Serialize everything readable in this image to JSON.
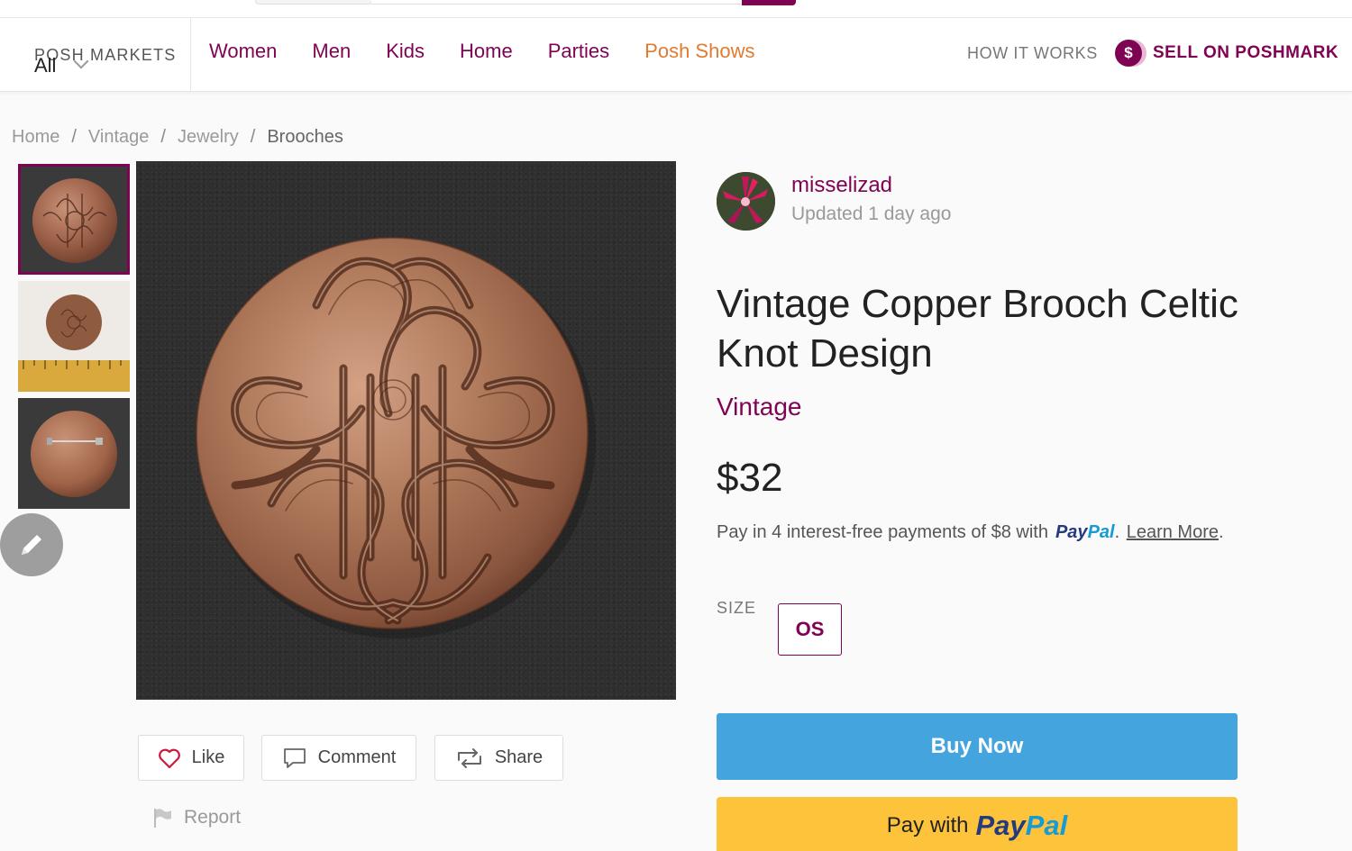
{
  "nav": {
    "markets_title": "POSH MARKETS",
    "markets_value": "All",
    "categories": [
      "Women",
      "Men",
      "Kids",
      "Home",
      "Parties",
      "Posh Shows"
    ],
    "how_it_works": "HOW IT WORKS",
    "sell_label": "SELL ON POSHMARK",
    "sell_icon": "$"
  },
  "breadcrumb": [
    "Home",
    "Vintage",
    "Jewelry",
    "Brooches"
  ],
  "breadcrumb_sep": "/",
  "seller": {
    "name": "misselizad",
    "updated": "Updated 1 day ago"
  },
  "listing": {
    "title": "Vintage Copper Brooch Celtic Knot Design",
    "brand": "Vintage",
    "price": "$32",
    "installment_text": "Pay in 4 interest-free payments of $8 with",
    "paypal_part1": "Pay",
    "paypal_part2": "Pal",
    "learn_more": "Learn More ",
    "size_label": "SIZE",
    "size_value": "OS"
  },
  "actions": {
    "like": "Like",
    "comment": "Comment",
    "share": "Share",
    "report": "Report"
  },
  "checkout": {
    "buy_now": "Buy Now",
    "pay_with": "Pay with",
    "paypal_part1": "Pay",
    "paypal_part2": "Pal"
  },
  "colors": {
    "brand": "#7f0353",
    "accent_orange": "#e07b31",
    "buy_blue": "#44a5de",
    "paypal_yellow": "#fdc33a"
  },
  "icons": [
    "chevron-down-icon",
    "dollar-icon",
    "heart-icon",
    "comment-icon",
    "share-icon",
    "flag-icon",
    "pencil-icon"
  ]
}
